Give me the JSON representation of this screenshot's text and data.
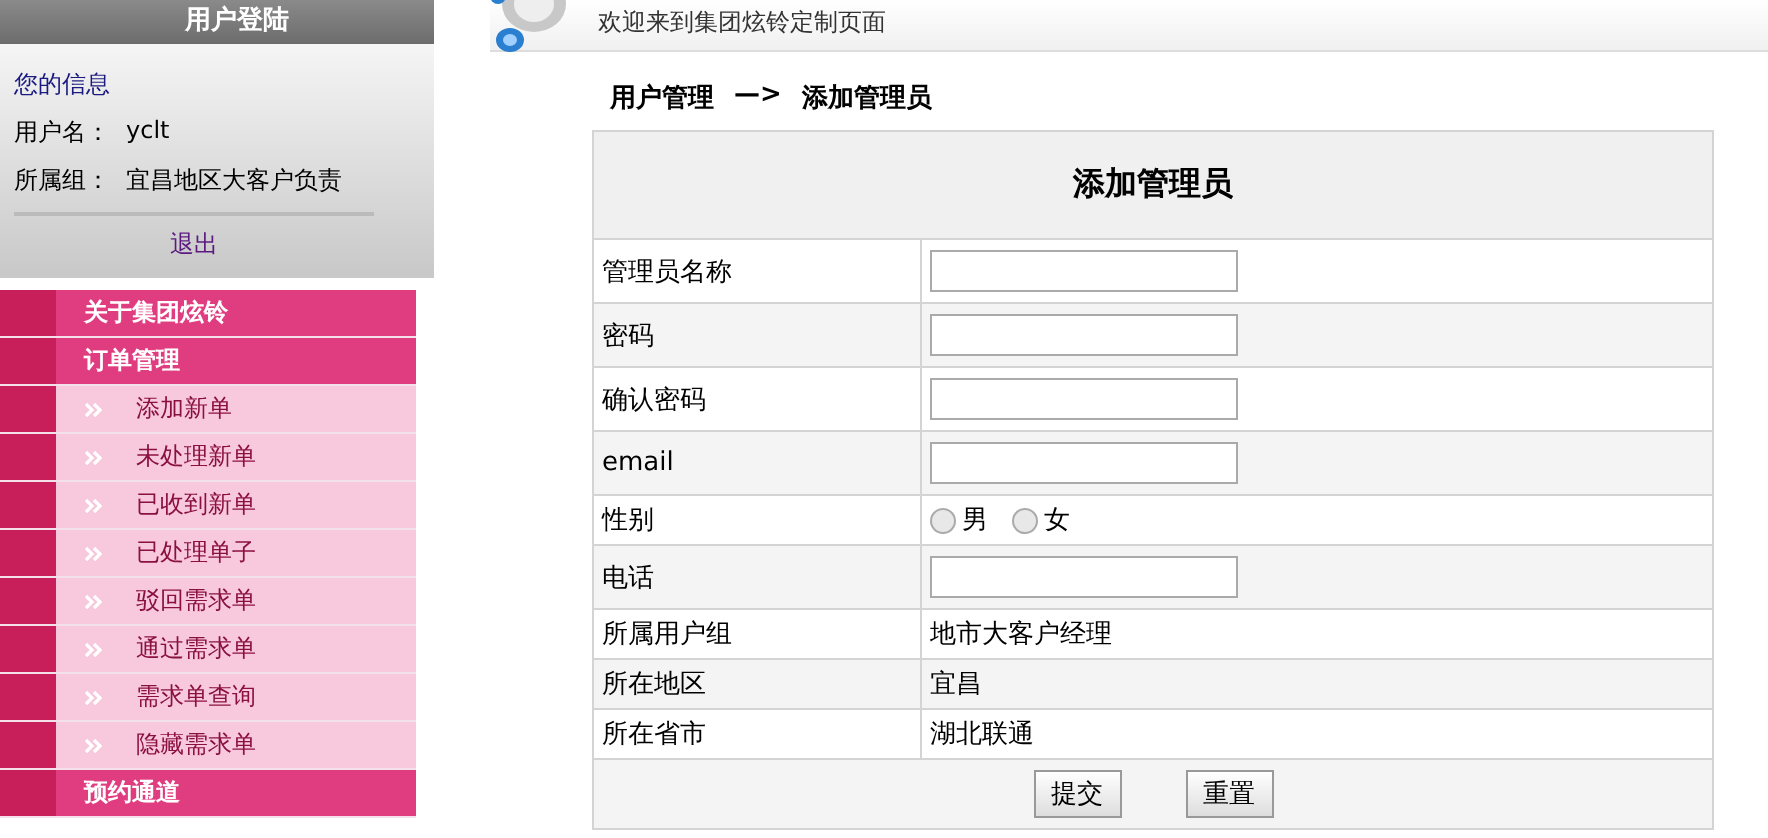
{
  "sidebar": {
    "header": "用户登陆",
    "info_title": "您的信息",
    "user_fields": [
      {
        "label": "用户名：",
        "value": "yclt"
      },
      {
        "label": "所属组：",
        "value": "宜昌地区大客户负责"
      }
    ],
    "logout": "退出",
    "menu": [
      {
        "kind": "section",
        "label": "关于集团炫铃"
      },
      {
        "kind": "section",
        "label": "订单管理"
      },
      {
        "kind": "item",
        "label": "添加新单"
      },
      {
        "kind": "item",
        "label": "未处理新单"
      },
      {
        "kind": "item",
        "label": "已收到新单"
      },
      {
        "kind": "item",
        "label": "已处理单子"
      },
      {
        "kind": "item",
        "label": "驳回需求单"
      },
      {
        "kind": "item",
        "label": "通过需求单"
      },
      {
        "kind": "item",
        "label": "需求单查询"
      },
      {
        "kind": "item",
        "label": "隐藏需求单"
      },
      {
        "kind": "section",
        "label": "预约通道"
      }
    ]
  },
  "header": {
    "welcome": "欢迎来到集团炫铃定制页面"
  },
  "breadcrumb": {
    "parent": "用户管理",
    "arrow": "—>",
    "current": "添加管理员"
  },
  "form": {
    "title": "添加管理员",
    "rows": [
      {
        "kind": "input",
        "label": "管理员名称"
      },
      {
        "kind": "input",
        "label": "密码"
      },
      {
        "kind": "input",
        "label": "确认密码"
      },
      {
        "kind": "input",
        "label": "email"
      },
      {
        "kind": "radio",
        "label": "性别",
        "options": [
          {
            "label": "男",
            "selected": false
          },
          {
            "label": "女",
            "selected": false
          }
        ]
      },
      {
        "kind": "input",
        "label": "电话"
      },
      {
        "kind": "text",
        "label": "所属用户组",
        "value": "地市大客户经理"
      },
      {
        "kind": "text",
        "label": "所在地区",
        "value": "宜昌"
      },
      {
        "kind": "text",
        "label": "所在省市",
        "value": "湖北联通"
      }
    ],
    "buttons": [
      "提交",
      "重置"
    ]
  }
}
